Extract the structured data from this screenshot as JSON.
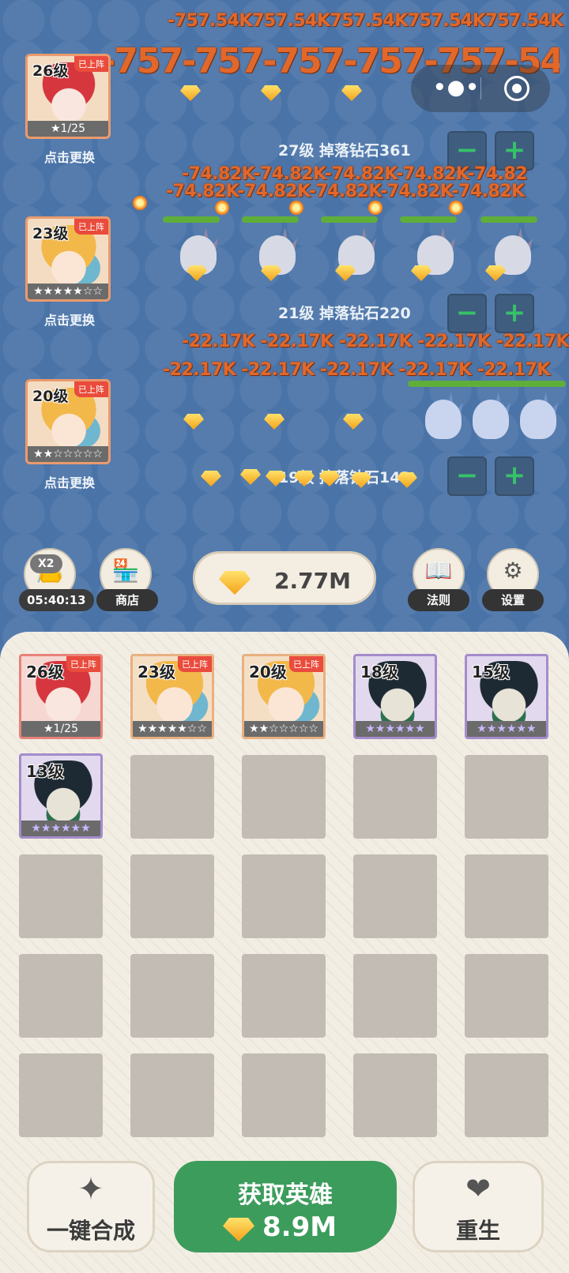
{
  "battle": {
    "top_damage_row": "-757.54K757.54K757.54K757.54K757.54K",
    "big_damage_row": "-757-757-757-757-757-54",
    "lane1_dmg_row_a": "-74.82K-74.82K-74.82K-74.82K-74.82",
    "lane1_dmg_row_b": "-74.82K-74.82K-74.82K-74.82K-74.82K",
    "lane2_dmg_row_a": "-22.17K -22.17K -22.17K -22.17K -22.17K",
    "lane2_dmg_row_b": "-22.17K -22.17K -22.17K -22.17K -22.17K",
    "lanes": [
      {
        "hero_level": "26级",
        "hero_badge": "已上阵",
        "hero_footer": "★1/25",
        "change_label": "点击更换",
        "drop_info": "27级 掉落钻石361"
      },
      {
        "hero_level": "23级",
        "hero_badge": "已上阵",
        "hero_footer": "★★★★★☆☆",
        "change_label": "点击更换",
        "drop_info": "21级 掉落钻石220"
      },
      {
        "hero_level": "20级",
        "hero_badge": "已上阵",
        "hero_footer": "★★☆☆☆☆☆",
        "change_label": "点击更换",
        "drop_info": "19级 掉落钻石143"
      }
    ],
    "minus_label": "−",
    "plus_label": "+"
  },
  "miniprogram_capsule": {
    "more_icon": "more-dots-icon",
    "close_icon": "target-icon"
  },
  "hud": {
    "bag_badge": "X2",
    "bag_timer": "05:40:13",
    "shop_label": "商店",
    "gem_total": "2.77M",
    "rules_label": "法则",
    "settings_label": "设置"
  },
  "roster": {
    "heroes": [
      {
        "level": "26级",
        "badge": "已上阵",
        "footer": "★1/25",
        "tier": "red"
      },
      {
        "level": "23级",
        "badge": "已上阵",
        "footer": "★★★★★☆☆",
        "tier": "orange"
      },
      {
        "level": "20级",
        "badge": "已上阵",
        "footer": "★★☆☆☆☆☆",
        "tier": "orange"
      },
      {
        "level": "18级",
        "badge": "",
        "footer": "★★★★★★",
        "tier": "purple"
      },
      {
        "level": "15级",
        "badge": "",
        "footer": "★★★★★★",
        "tier": "purple"
      },
      {
        "level": "13级",
        "badge": "",
        "footer": "★★★★★★",
        "tier": "purple"
      }
    ]
  },
  "actions": {
    "merge_label": "一键合成",
    "get_hero_label": "获取英雄",
    "get_hero_cost": "8.9M",
    "reborn_label": "重生"
  },
  "colors": {
    "accent_green": "#3c9c5c",
    "damage_orange": "#e2682a",
    "battle_bg": "#4a74a8"
  }
}
